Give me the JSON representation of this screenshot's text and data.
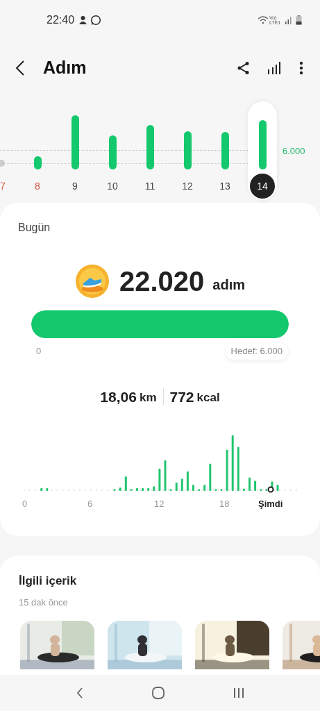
{
  "status_bar": {
    "time": "22:40",
    "network": "Vo) LTE1"
  },
  "header": {
    "title": "Adım"
  },
  "week_chart": {
    "goal_label": "6.000",
    "days": [
      {
        "label": "7",
        "weekend": true,
        "selected": false
      },
      {
        "label": "8",
        "weekend": true,
        "selected": false
      },
      {
        "label": "9",
        "weekend": false,
        "selected": false
      },
      {
        "label": "10",
        "weekend": false,
        "selected": false
      },
      {
        "label": "11",
        "weekend": false,
        "selected": false
      },
      {
        "label": "12",
        "weekend": false,
        "selected": false
      },
      {
        "label": "13",
        "weekend": false,
        "selected": false
      },
      {
        "label": "14",
        "weekend": false,
        "selected": true
      }
    ]
  },
  "today": {
    "title": "Bugün",
    "steps": "22.020",
    "unit": "adım",
    "progress": {
      "level": 1,
      "start_label": "0",
      "goal_label": "Hedef: 6.000"
    },
    "stats": [
      {
        "value": "18,06",
        "unit": "km"
      },
      {
        "value": "772",
        "unit": "kcal"
      }
    ],
    "hourly_axis": [
      "0",
      "6",
      "12",
      "18",
      "Şimdi"
    ]
  },
  "related": {
    "title": "İlgili içerik",
    "subtitle": "15 dak önce"
  }
}
